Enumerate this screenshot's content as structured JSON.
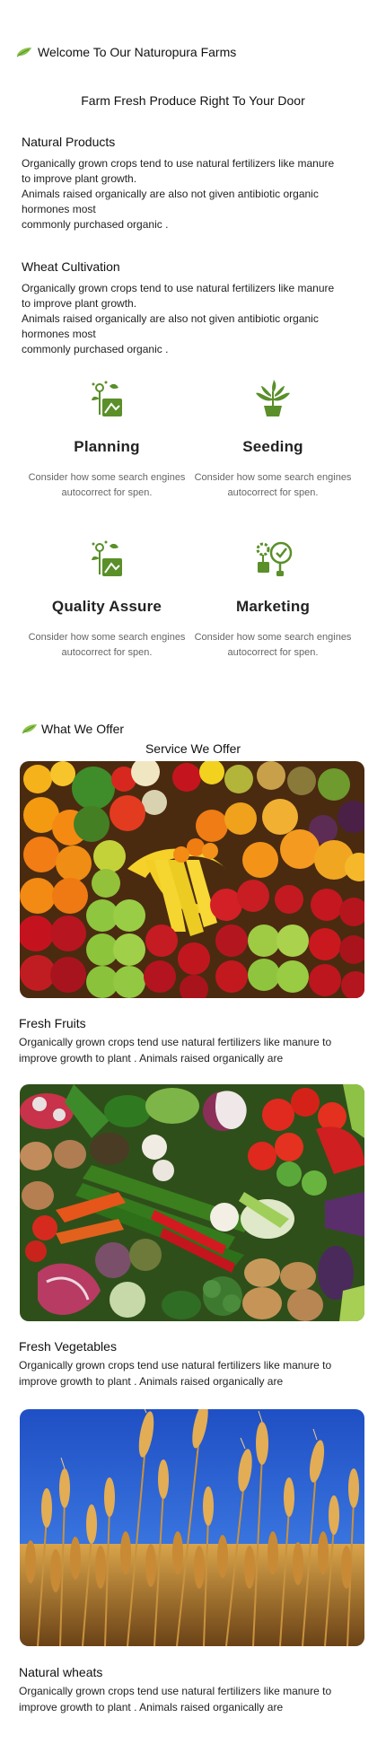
{
  "header": {
    "title": "Welcome To Our Naturopura Farms",
    "leaf_icon": "leaf-icon"
  },
  "tagline": "Farm Fresh Produce Right To Your Door",
  "sections": [
    {
      "title": "Natural Products",
      "body": "Organically grown crops tend to use natural fertilizers like manure\nto improve plant growth.\nAnimals raised organically are also not given antibiotic organic\nhormones most\ncommonly purchased organic ."
    },
    {
      "title": "Wheat Cultivation",
      "body": "Organically grown crops tend to use natural fertilizers like manure\nto improve plant growth.\nAnimals raised organically are also not given antibiotic organic\nhormones most\ncommonly purchased organic ."
    }
  ],
  "features": [
    {
      "title": "Planning",
      "desc": "Consider how some search engines autocorrect for spen.",
      "icon": "planning-icon"
    },
    {
      "title": "Seeding",
      "desc": "Consider how some search engines autocorrect for spen.",
      "icon": "seedling-icon"
    },
    {
      "title": "Quality Assure",
      "desc": "Consider how some search engines autocorrect for spen.",
      "icon": "quality-icon"
    },
    {
      "title": "Marketing",
      "desc": "Consider how some search engines autocorrect for spen.",
      "icon": "marketing-icon"
    }
  ],
  "offer": {
    "heading": "What We Offer",
    "service_title": "Service We Offer"
  },
  "cards": [
    {
      "title": "Fresh Fruits",
      "desc": "Organically grown crops tend use natural fertilizers like manure to improve growth to plant . Animals raised organically are"
    },
    {
      "title": "Fresh Vegetables",
      "desc": "Organically grown crops tend use natural fertilizers like manure to improve growth to plant . Animals raised organically are"
    },
    {
      "title": "Natural wheats",
      "desc": "Organically grown crops tend use natural fertilizers like manure to improve growth to plant . Animals raised organically are"
    }
  ],
  "colors": {
    "accent_green": "#5a8f2a",
    "leaf_green": "#8bc34a",
    "text": "#111111",
    "muted_text": "#666666"
  }
}
